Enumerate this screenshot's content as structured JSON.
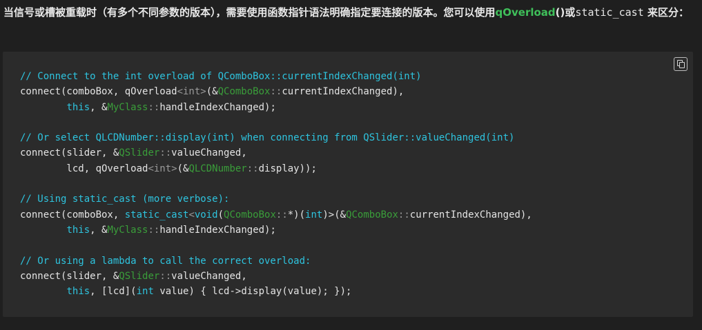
{
  "paragraph": {
    "text_before": "当信号或槽被重载时（有多个不同参数的版本），需要使用函数指针语法明确指定要连接的版本。您可以使用",
    "inline_func": "qOverload",
    "inline_parens": "()",
    "text_mid": "或",
    "inline_static_cast": "static_cast",
    "text_after": " 来区分："
  },
  "code_block": {
    "copy_button_icon": "copy-icon",
    "colors": {
      "background": "#2b2b2b",
      "comment": "#2ec4df",
      "type_name": "#3a9e3a",
      "keyword": "#2ec4df",
      "plain": "#e4e4e4"
    },
    "lines": [
      [
        {
          "t": "// Connect to the int overload of QComboBox::currentIndexChanged(int)",
          "c": "comment"
        }
      ],
      [
        {
          "t": "connect(comboBox, qOverload",
          "c": "plain"
        },
        {
          "t": "<int>",
          "c": "punc"
        },
        {
          "t": "(&",
          "c": "plain"
        },
        {
          "t": "QComboBox",
          "c": "type"
        },
        {
          "t": "::",
          "c": "punc"
        },
        {
          "t": "currentIndexChanged),",
          "c": "plain"
        }
      ],
      [
        {
          "t": "        ",
          "c": "plain"
        },
        {
          "t": "this",
          "c": "kw"
        },
        {
          "t": ", &",
          "c": "plain"
        },
        {
          "t": "MyClass",
          "c": "type"
        },
        {
          "t": "::",
          "c": "punc"
        },
        {
          "t": "handleIndexChanged);",
          "c": "plain"
        }
      ],
      [],
      [
        {
          "t": "// Or select QLCDNumber::display(int) when connecting from QSlider::valueChanged(int)",
          "c": "comment"
        }
      ],
      [
        {
          "t": "connect(slider, &",
          "c": "plain"
        },
        {
          "t": "QSlider",
          "c": "type"
        },
        {
          "t": "::",
          "c": "punc"
        },
        {
          "t": "valueChanged,",
          "c": "plain"
        }
      ],
      [
        {
          "t": "        lcd, qOverload",
          "c": "plain"
        },
        {
          "t": "<int>",
          "c": "punc"
        },
        {
          "t": "(&",
          "c": "plain"
        },
        {
          "t": "QLCDNumber",
          "c": "type"
        },
        {
          "t": "::",
          "c": "punc"
        },
        {
          "t": "display));",
          "c": "plain"
        }
      ],
      [],
      [
        {
          "t": "// Using static_cast (more verbose):",
          "c": "comment"
        }
      ],
      [
        {
          "t": "connect(comboBox, ",
          "c": "plain"
        },
        {
          "t": "static_cast",
          "c": "kw"
        },
        {
          "t": "<",
          "c": "punc"
        },
        {
          "t": "void",
          "c": "kw"
        },
        {
          "t": "(",
          "c": "plain"
        },
        {
          "t": "QComboBox",
          "c": "type"
        },
        {
          "t": "::",
          "c": "punc"
        },
        {
          "t": "*)(",
          "c": "plain"
        },
        {
          "t": "int",
          "c": "kw"
        },
        {
          "t": ")>",
          "c": "plain"
        },
        {
          "t": "(&",
          "c": "plain"
        },
        {
          "t": "QComboBox",
          "c": "type"
        },
        {
          "t": "::",
          "c": "punc"
        },
        {
          "t": "currentIndexChanged),",
          "c": "plain"
        }
      ],
      [
        {
          "t": "        ",
          "c": "plain"
        },
        {
          "t": "this",
          "c": "kw"
        },
        {
          "t": ", &",
          "c": "plain"
        },
        {
          "t": "MyClass",
          "c": "type"
        },
        {
          "t": "::",
          "c": "punc"
        },
        {
          "t": "handleIndexChanged);",
          "c": "plain"
        }
      ],
      [],
      [
        {
          "t": "// Or using a lambda to call the correct overload:",
          "c": "comment"
        }
      ],
      [
        {
          "t": "connect(slider, &",
          "c": "plain"
        },
        {
          "t": "QSlider",
          "c": "type"
        },
        {
          "t": "::",
          "c": "punc"
        },
        {
          "t": "valueChanged,",
          "c": "plain"
        }
      ],
      [
        {
          "t": "        ",
          "c": "plain"
        },
        {
          "t": "this",
          "c": "kw"
        },
        {
          "t": ", [lcd](",
          "c": "plain"
        },
        {
          "t": "int",
          "c": "kw"
        },
        {
          "t": " value) { lcd->display(value); });",
          "c": "plain"
        }
      ]
    ]
  }
}
